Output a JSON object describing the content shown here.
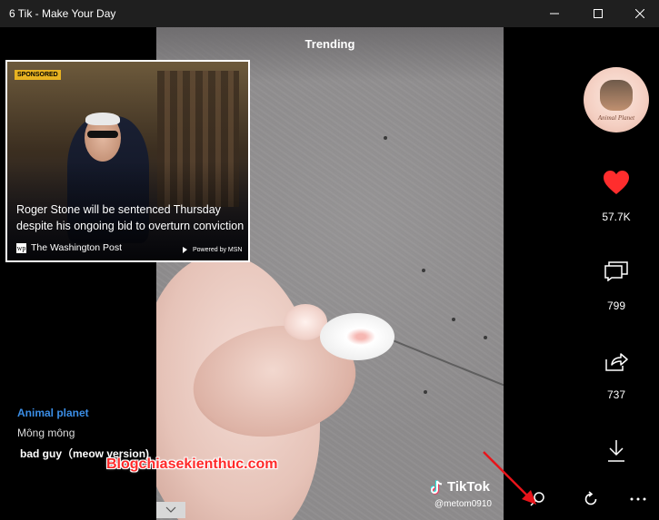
{
  "window": {
    "title": "6 Tik - Make Your Day"
  },
  "video": {
    "tab_label": "Trending",
    "watermark": "TikTok",
    "username": "@metom0910"
  },
  "ad": {
    "badge": "SPONSORED",
    "headline": "Roger Stone will be sentenced Thursday despite his ongoing bid to overturn conviction",
    "source_logo": "wp",
    "source": "The Washington Post",
    "powered_by": "Powered by MSN"
  },
  "creator": {
    "name": "Animal planet",
    "caption": "Mông mông",
    "music": "bad guy（meow version)"
  },
  "sidebar": {
    "avatar_text": "Animal Planet",
    "likes": "57.7K",
    "comments": "799",
    "shares": "737"
  },
  "overlay": {
    "blog_watermark": "Blogchiasekienthuc.com"
  },
  "colors": {
    "like": "#ff2d2d",
    "creator_name": "#3b8ee6",
    "annotation_arrow": "#e8141a"
  },
  "icons": [
    "minimize-icon",
    "maximize-icon",
    "close-icon",
    "heart-icon",
    "comment-icon",
    "share-icon",
    "download-icon",
    "search-icon",
    "refresh-icon",
    "more-icon",
    "chevron-down-icon",
    "tiktok-icon"
  ]
}
